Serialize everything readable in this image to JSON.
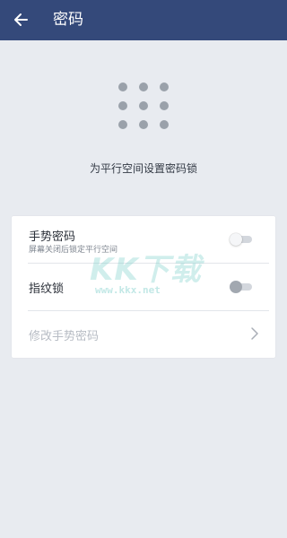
{
  "header": {
    "back_icon": "arrow-left-icon",
    "title": "密码"
  },
  "pattern": {
    "icon": "pattern-dots-icon",
    "caption": "为平行空间设置密码锁"
  },
  "settings": {
    "gesture": {
      "label": "手势密码",
      "sublabel": "屏幕关闭后锁定平行空间",
      "enabled": false
    },
    "fingerprint": {
      "label": "指纹锁",
      "enabled": false
    },
    "change_gesture": {
      "label": "修改手势密码",
      "icon": "chevron-right-icon"
    }
  },
  "watermark": {
    "main": "KK下载",
    "url": "www.kkx.net"
  },
  "colors": {
    "header_bg": "#34497a",
    "page_bg": "#e8ebf0",
    "card_bg": "#ffffff"
  }
}
